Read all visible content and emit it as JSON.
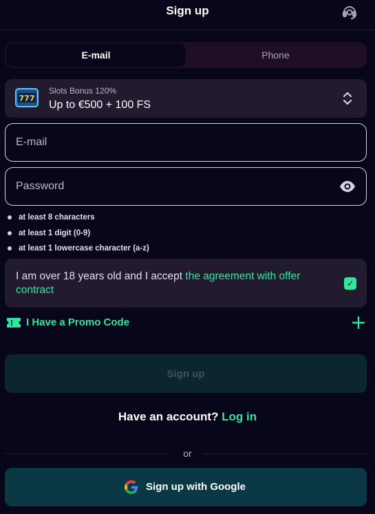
{
  "header": {
    "title": "Sign up",
    "support_icon": "headset-icon"
  },
  "tabs": [
    {
      "label": "E-mail",
      "active": true
    },
    {
      "label": "Phone",
      "active": false
    }
  ],
  "bonus": {
    "icon": "slot-machine-777-icon",
    "name": "Slots Bonus 120%",
    "description": "Up to €500 + 100 FS"
  },
  "form": {
    "email_placeholder": "E-mail",
    "password_placeholder": "Password"
  },
  "password_rules": [
    "at least 8 characters",
    "at least 1 digit (0-9)",
    "at least 1 lowercase character (a-z)"
  ],
  "agreement": {
    "text": "I am over 18 years old and I accept ",
    "link": "the agreement with offer contract",
    "checked": true
  },
  "promo": {
    "label": "I Have a Promo Code"
  },
  "signup_button": "Sign up",
  "account": {
    "question": "Have an account?",
    "login": "Log in"
  },
  "divider": "or",
  "google_button": "Sign up with Google",
  "colors": {
    "background": "#07061a",
    "accent": "#2ee89c",
    "card": "#221a2f",
    "google_button": "#0a3945"
  }
}
